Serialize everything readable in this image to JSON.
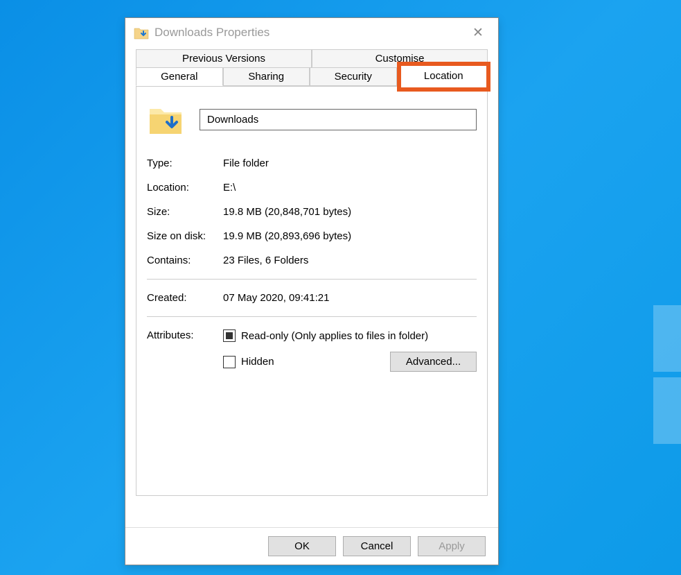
{
  "window": {
    "title": "Downloads Properties"
  },
  "tabs": {
    "row1": [
      "Previous Versions",
      "Customise"
    ],
    "row2": [
      "General",
      "Sharing",
      "Security",
      "Location"
    ]
  },
  "folder": {
    "name": "Downloads"
  },
  "props": {
    "type_label": "Type:",
    "type_value": "File folder",
    "location_label": "Location:",
    "location_value": "E:\\",
    "size_label": "Size:",
    "size_value": "19.8 MB (20,848,701 bytes)",
    "sizeondisk_label": "Size on disk:",
    "sizeondisk_value": "19.9 MB (20,893,696 bytes)",
    "contains_label": "Contains:",
    "contains_value": "23 Files, 6 Folders",
    "created_label": "Created:",
    "created_value": "07 May 2020, 09:41:21"
  },
  "attributes": {
    "label": "Attributes:",
    "readonly": "Read-only (Only applies to files in folder)",
    "hidden": "Hidden",
    "advanced": "Advanced..."
  },
  "buttons": {
    "ok": "OK",
    "cancel": "Cancel",
    "apply": "Apply"
  }
}
